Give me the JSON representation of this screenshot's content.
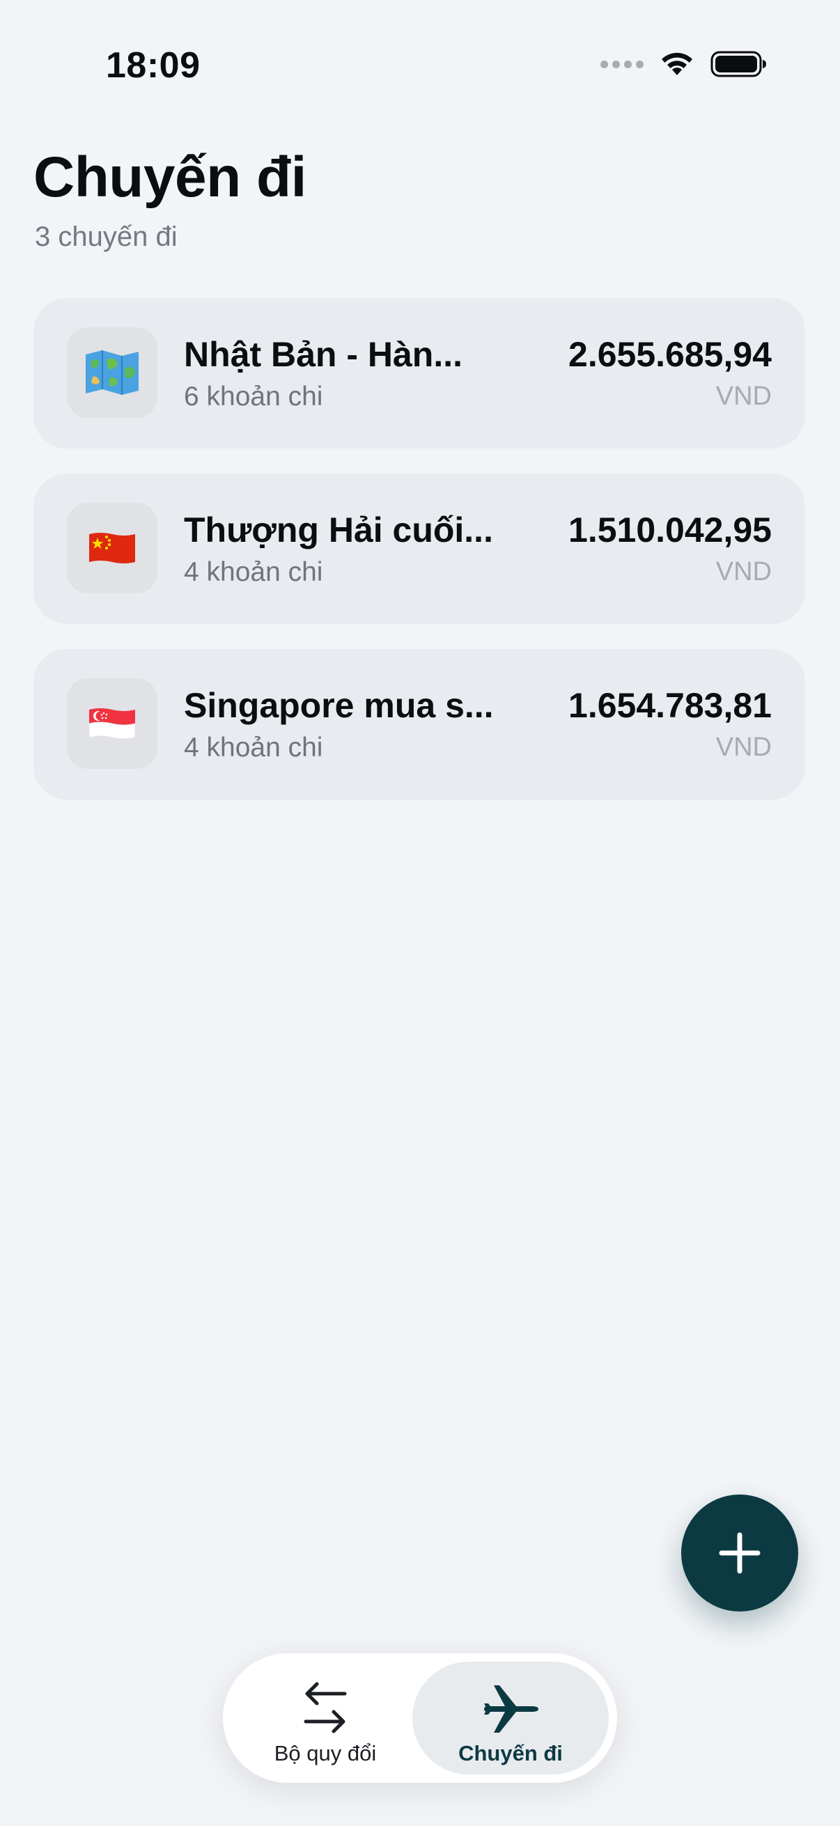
{
  "status_bar": {
    "time": "18:09"
  },
  "header": {
    "title": "Chuyến đi",
    "subtitle": "3 chuyến đi"
  },
  "trips": [
    {
      "name": "Nhật Bản - Hàn...",
      "count": "6 khoản chi",
      "amount": "2.655.685,94",
      "currency": "VND",
      "icon": "world-map-icon"
    },
    {
      "name": "Thượng Hải cuối...",
      "count": "4 khoản chi",
      "amount": "1.510.042,95",
      "currency": "VND",
      "icon": "china-flag-icon"
    },
    {
      "name": "Singapore mua s...",
      "count": "4 khoản chi",
      "amount": "1.654.783,81",
      "currency": "VND",
      "icon": "singapore-flag-icon"
    }
  ],
  "fab": {
    "icon": "plus-icon"
  },
  "tab_bar": {
    "tabs": [
      {
        "label": "Bộ quy đổi",
        "icon": "swap-arrows-icon",
        "active": false
      },
      {
        "label": "Chuyến đi",
        "icon": "airplane-icon",
        "active": true
      }
    ]
  },
  "colors": {
    "accent": "#0c3a42",
    "background": "#f2f4f7",
    "card": "#e8ebef"
  }
}
